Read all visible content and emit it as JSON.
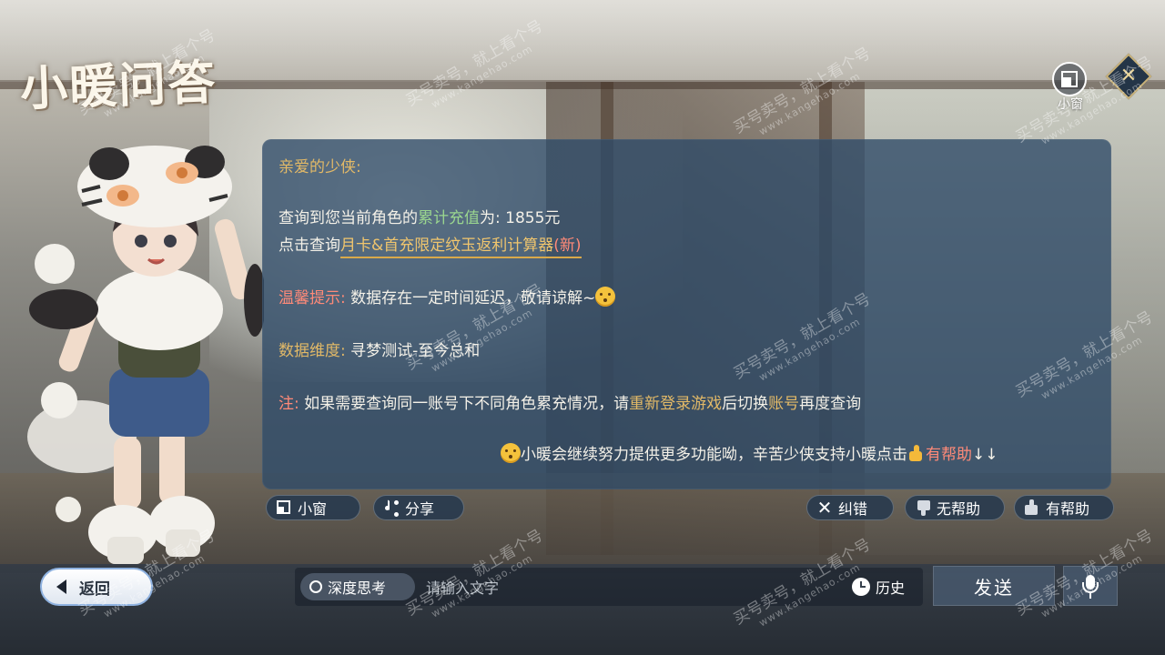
{
  "header": {
    "title": "小暖问答"
  },
  "top_right": {
    "mini_window_label": "小窗",
    "mini_window_icon": "mini-window-icon",
    "close_icon": "close-icon"
  },
  "message": {
    "greeting": "亲爱的少侠:",
    "line1_prefix": "查询到您当前角色的",
    "line1_highlight": "累计充值",
    "line1_suffix": "为: 1855元",
    "line2_prefix": "点击查询",
    "line2_link": "月卡&首充限定纹玉返利计算器",
    "line2_new": "(新)",
    "tip_label": "温馨提示:",
    "tip_text": "数据存在一定时间延迟，敬请谅解~",
    "dimension_label": "数据维度:",
    "dimension_text": "寻梦测试-至今总和",
    "note_label": "注:",
    "note_text1": "如果需要查询同一账号下不同角色累充情况，请",
    "note_highlight1": "重新登录游戏",
    "note_text2": "后切换",
    "note_highlight2": "账号",
    "note_text3": "再度查询",
    "closing_text": "小暖会继续努力提供更多功能呦，辛苦少侠支持小暖点击",
    "closing_helpful": "有帮助",
    "closing_arrows": "↓↓"
  },
  "actions": {
    "mini_window": "小窗",
    "share": "分享",
    "correct": "纠错",
    "not_helpful": "无帮助",
    "helpful": "有帮助"
  },
  "bottom": {
    "back": "返回",
    "deep_think": "深度思考",
    "input_placeholder": "请输入文字",
    "history": "历史",
    "send": "发送"
  },
  "watermark": {
    "line1": "买号卖号，就上看个号",
    "line2": "www.kangehao.com"
  },
  "colors": {
    "panel": "#2e4a68",
    "gold": "#e2b967",
    "green": "#9ad68f",
    "red": "#ff8a78"
  }
}
